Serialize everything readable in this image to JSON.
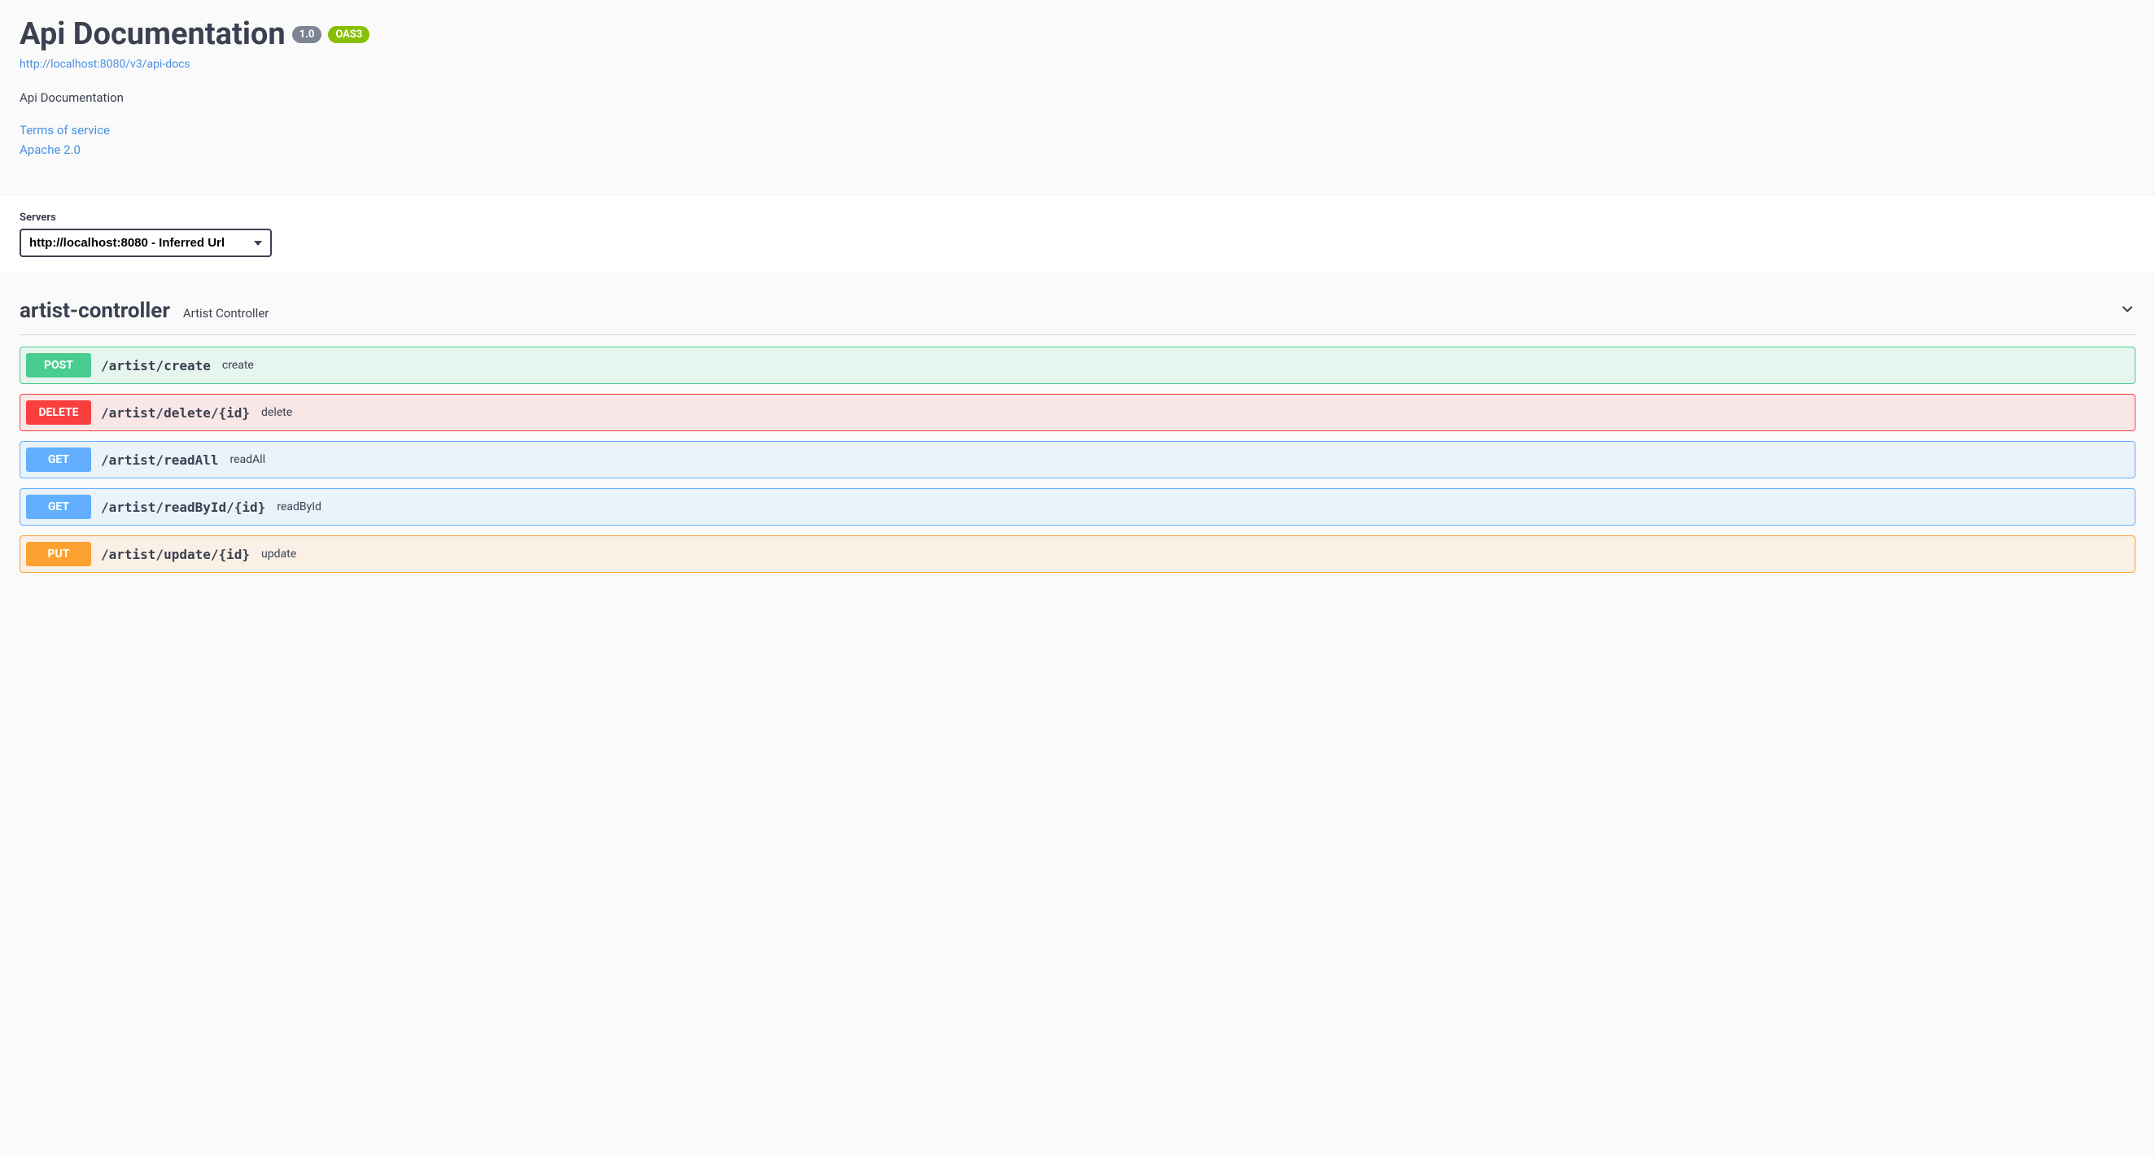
{
  "header": {
    "title": "Api Documentation",
    "version": "1.0",
    "oas": "OAS3",
    "url": "http://localhost:8080/v3/api-docs",
    "description": "Api Documentation",
    "terms_link": "Terms of service",
    "license_link": "Apache 2.0"
  },
  "servers": {
    "label": "Servers",
    "selected": "http://localhost:8080 - Inferred Url"
  },
  "controller": {
    "name": "artist-controller",
    "description": "Artist Controller"
  },
  "operations": [
    {
      "method": "POST",
      "method_class": "post",
      "path": "/artist/create",
      "summary": "create"
    },
    {
      "method": "DELETE",
      "method_class": "delete",
      "path": "/artist/delete/{id}",
      "summary": "delete"
    },
    {
      "method": "GET",
      "method_class": "get",
      "path": "/artist/readAll",
      "summary": "readAll"
    },
    {
      "method": "GET",
      "method_class": "get",
      "path": "/artist/readById/{id}",
      "summary": "readById"
    },
    {
      "method": "PUT",
      "method_class": "put",
      "path": "/artist/update/{id}",
      "summary": "update"
    }
  ]
}
